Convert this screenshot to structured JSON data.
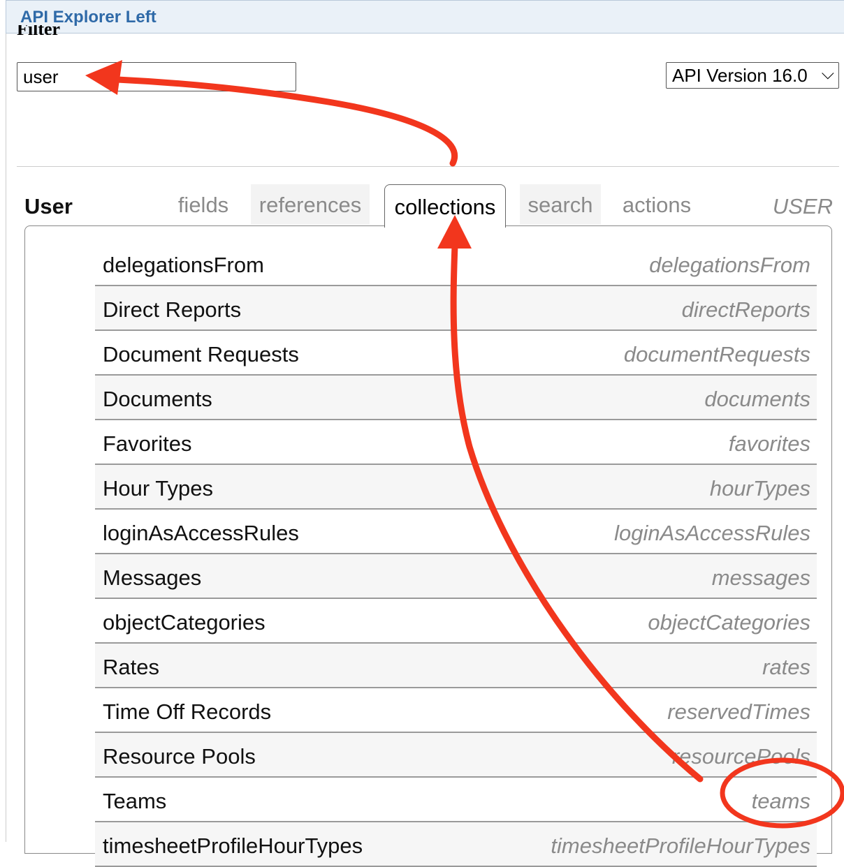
{
  "window": {
    "title": "API Explorer Left"
  },
  "filter": {
    "label": "Filter",
    "value": "user"
  },
  "version": {
    "selected": "API Version 16.0",
    "chevron": "⌵"
  },
  "object": {
    "name": "User",
    "api_name": "USER"
  },
  "tabs": [
    {
      "label": "fields",
      "active": false
    },
    {
      "label": "references",
      "active": false
    },
    {
      "label": "collections",
      "active": true
    },
    {
      "label": "search",
      "active": false
    },
    {
      "label": "actions",
      "active": false
    }
  ],
  "collections": [
    {
      "label": "delegationsFrom",
      "api": "delegationsFrom"
    },
    {
      "label": "Direct Reports",
      "api": "directReports"
    },
    {
      "label": "Document Requests",
      "api": "documentRequests"
    },
    {
      "label": "Documents",
      "api": "documents"
    },
    {
      "label": "Favorites",
      "api": "favorites"
    },
    {
      "label": "Hour Types",
      "api": "hourTypes"
    },
    {
      "label": "loginAsAccessRules",
      "api": "loginAsAccessRules"
    },
    {
      "label": "Messages",
      "api": "messages"
    },
    {
      "label": "objectCategories",
      "api": "objectCategories"
    },
    {
      "label": "Rates",
      "api": "rates"
    },
    {
      "label": "Time Off Records",
      "api": "reservedTimes"
    },
    {
      "label": "Resource Pools",
      "api": "resourcePools"
    },
    {
      "label": "Teams",
      "api": "teams"
    },
    {
      "label": "timesheetProfileHourTypes",
      "api": "timesheetProfileHourTypes"
    }
  ],
  "annotation": {
    "color": "#f2361d"
  }
}
